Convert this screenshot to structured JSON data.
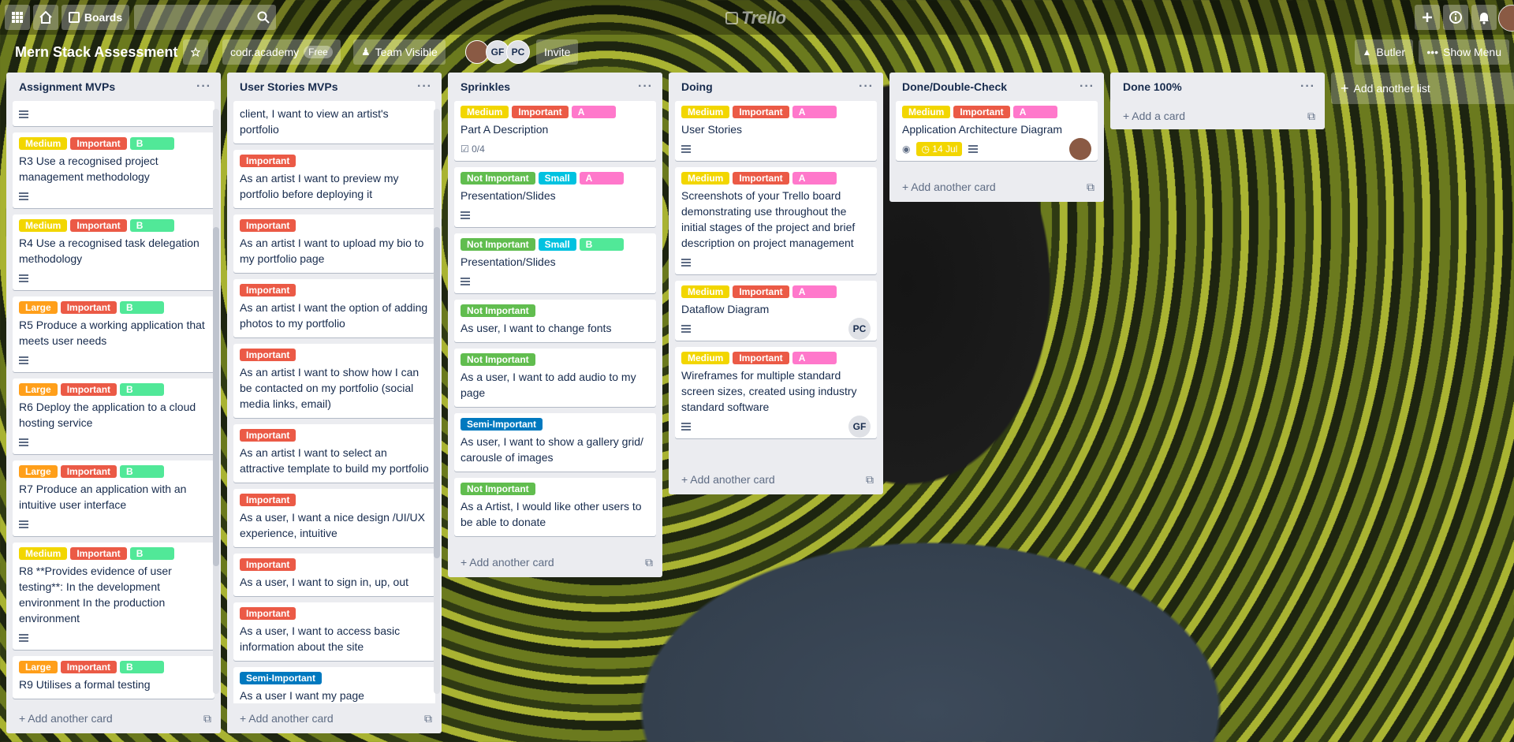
{
  "header": {
    "boards_label": "Boards",
    "logo": "Trello"
  },
  "board": {
    "title": "Mern Stack Assessment",
    "workspace": "codr.academy",
    "plan": "Free",
    "visibility": "Team Visible",
    "members": [
      "GF",
      "PC"
    ],
    "invite_label": "Invite",
    "butler_label": "Butler",
    "menu_label": "Show Menu"
  },
  "colors": {
    "medium": "#f2d600",
    "important": "#eb5a46",
    "not_important": "#61bd4f",
    "semi_important": "#0079bf",
    "small": "#00c2e0",
    "large": "#ff9f1a",
    "a": "#ff78cb",
    "b": "#51e898"
  },
  "lists": [
    {
      "title": "Assignment MVPs",
      "add_label": "Add another card",
      "cards": [
        {
          "labels": [],
          "title": "",
          "desc": true
        },
        {
          "labels": [
            "Medium",
            "Important",
            "B"
          ],
          "title": "R3 Use a recognised project management methodology",
          "desc": true
        },
        {
          "labels": [
            "Medium",
            "Important",
            "B"
          ],
          "title": "R4 Use a recognised task delegation methodology",
          "desc": true
        },
        {
          "labels": [
            "Large",
            "Important",
            "B"
          ],
          "title": "R5 Produce a working application that meets user needs",
          "desc": true
        },
        {
          "labels": [
            "Large",
            "Important",
            "B"
          ],
          "title": "R6 Deploy the application to a cloud hosting service",
          "desc": true
        },
        {
          "labels": [
            "Large",
            "Important",
            "B"
          ],
          "title": "R7 Produce an application with an intuitive user interface",
          "desc": true
        },
        {
          "labels": [
            "Medium",
            "Important",
            "B"
          ],
          "title": "R8 **Provides evidence of user testing**: In the development environment In the production environment",
          "desc": true
        },
        {
          "labels": [
            "Large",
            "Important",
            "B"
          ],
          "title": "R9 Utilises a formal testing",
          "desc": false
        }
      ]
    },
    {
      "title": "User Stories MVPs",
      "add_label": "Add another card",
      "cards": [
        {
          "labels": [],
          "title": "client, I want to view an artist's portfolio",
          "desc": false
        },
        {
          "labels": [
            "Important"
          ],
          "title": "As an artist I want to preview my portfolio before deploying it",
          "desc": false
        },
        {
          "labels": [
            "Important"
          ],
          "title": "As an artist I want to upload my bio to my portfolio page",
          "desc": false
        },
        {
          "labels": [
            "Important"
          ],
          "title": "As an artist I want the option of adding photos to my portfolio",
          "desc": false
        },
        {
          "labels": [
            "Important"
          ],
          "title": "As an artist I want to show how I can be contacted on my portfolio (social media links, email)",
          "desc": false
        },
        {
          "labels": [
            "Important"
          ],
          "title": "As an artist I want to select an attractive template to build my portfolio",
          "desc": false
        },
        {
          "labels": [
            "Important"
          ],
          "title": "As a user, I want a nice design /UI/UX experience, intuitive",
          "desc": false
        },
        {
          "labels": [
            "Important"
          ],
          "title": "As a user, I want to sign in, up, out",
          "desc": false
        },
        {
          "labels": [
            "Important"
          ],
          "title": "As a user, I want to access basic information about the site",
          "desc": false
        },
        {
          "labels": [
            "Semi-Important"
          ],
          "title": "As a user I want my page",
          "desc": false
        }
      ]
    },
    {
      "title": "Sprinkles",
      "add_label": "Add another card",
      "cards": [
        {
          "labels": [
            "Medium",
            "Important",
            "A"
          ],
          "title": "Part A Description",
          "checklist": "0/4"
        },
        {
          "labels": [
            "Not Important",
            "Small",
            "A"
          ],
          "title": "Presentation/Slides",
          "desc": true
        },
        {
          "labels": [
            "Not Important",
            "Small",
            "B"
          ],
          "title": "Presentation/Slides",
          "desc": true
        },
        {
          "labels": [
            "Not Important"
          ],
          "title": "As user, I want to change fonts",
          "desc": false
        },
        {
          "labels": [
            "Not Important"
          ],
          "title": "As a user, I want to add audio to my page",
          "desc": false
        },
        {
          "labels": [
            "Semi-Important"
          ],
          "title": "As user, I want to show a gallery grid/ carousle of images",
          "desc": false
        },
        {
          "labels": [
            "Not Important"
          ],
          "title": "As a Artist, I would like other users to be able to donate",
          "desc": false
        }
      ]
    },
    {
      "title": "Doing",
      "add_label": "Add another card",
      "cards": [
        {
          "labels": [
            "Medium",
            "Important",
            "A"
          ],
          "title": "User Stories",
          "desc": true
        },
        {
          "labels": [
            "Medium",
            "Important",
            "A"
          ],
          "title": "Screenshots of your Trello board demonstrating use throughout the initial stages of the project and brief description on project management",
          "desc": true
        },
        {
          "labels": [
            "Medium",
            "Important",
            "A"
          ],
          "title": "Dataflow Diagram",
          "desc": true,
          "member": "PC"
        },
        {
          "labels": [
            "Medium",
            "Important",
            "A"
          ],
          "title": "Wireframes for multiple standard screen sizes, created using industry standard software",
          "desc": true,
          "member": "GF"
        }
      ]
    },
    {
      "title": "Done/Double-Check",
      "add_label": "Add another card",
      "cards": [
        {
          "labels": [
            "Medium",
            "Important",
            "A"
          ],
          "title": "Application Architecture Diagram",
          "desc": true,
          "watch": true,
          "due": "14 Jul",
          "member": "avatar"
        }
      ]
    },
    {
      "title": "Done 100%",
      "add_label": "Add a card",
      "cards": []
    }
  ],
  "add_list_label": "Add another list"
}
